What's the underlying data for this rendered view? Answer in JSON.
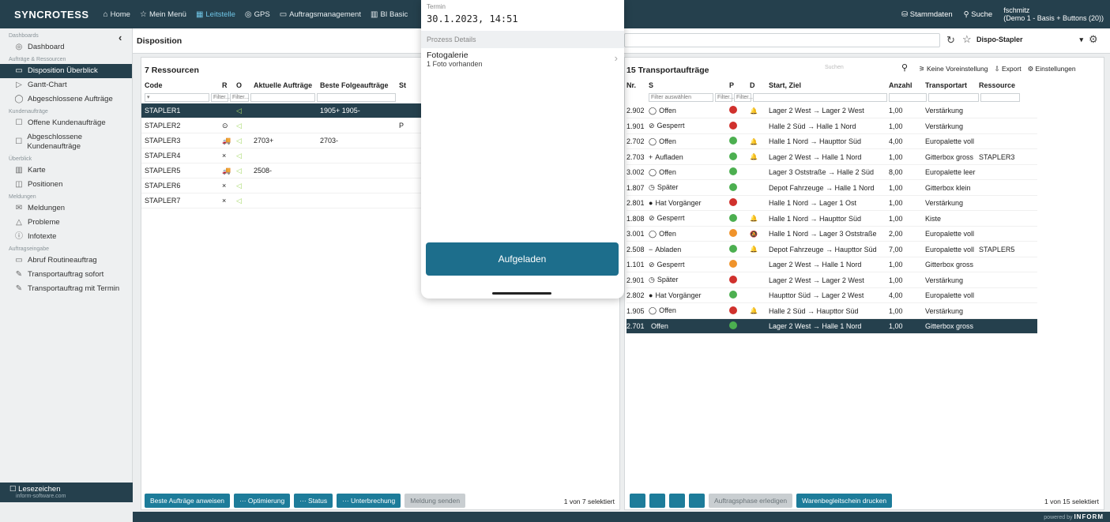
{
  "app": {
    "brand": "SYNCROTESS"
  },
  "topnav": [
    {
      "label": "Home",
      "icon": "⌂",
      "active": false
    },
    {
      "label": "Mein Menü",
      "icon": "☆",
      "active": false
    },
    {
      "label": "Leitstelle",
      "icon": "▦",
      "active": true
    },
    {
      "label": "GPS",
      "icon": "◎",
      "active": false
    },
    {
      "label": "Auftragsmanagement",
      "icon": "▭",
      "active": false
    },
    {
      "label": "BI Basic",
      "icon": "▥",
      "active": false
    }
  ],
  "topright": {
    "stammdaten": "Stammdaten",
    "suche": "Suche",
    "user": "fschmitz",
    "user_detail": "(Demo 1 - Basis + Buttons (20))"
  },
  "sidebar": {
    "groups": [
      {
        "title": "Dashboards",
        "items": [
          {
            "label": "Dashboard",
            "icon": "◎"
          }
        ]
      },
      {
        "title": "Aufträge & Ressourcen",
        "items": [
          {
            "label": "Disposition Überblick",
            "icon": "▭",
            "active": true
          },
          {
            "label": "Gantt-Chart",
            "icon": "▷"
          },
          {
            "label": "Abgeschlossene Aufträge",
            "icon": "◯"
          }
        ]
      },
      {
        "title": "Kundenaufträge",
        "items": [
          {
            "label": "Offene Kundenaufträge",
            "icon": "☐"
          },
          {
            "label": "Abgeschlossene Kundenaufträge",
            "icon": "☐"
          }
        ]
      },
      {
        "title": "Überblick",
        "items": [
          {
            "label": "Karte",
            "icon": "▥"
          },
          {
            "label": "Positionen",
            "icon": "◫"
          }
        ]
      },
      {
        "title": "Meldungen",
        "items": [
          {
            "label": "Meldungen",
            "icon": "✉"
          },
          {
            "label": "Probleme",
            "icon": "△"
          },
          {
            "label": "Infotexte",
            "icon": "ⓘ"
          }
        ]
      },
      {
        "title": "Auftragseingabe",
        "items": [
          {
            "label": "Abruf Routineauftrag",
            "icon": "▭"
          },
          {
            "label": "Transportauftrag sofort",
            "icon": "✎"
          },
          {
            "label": "Transportauftrag mit Termin",
            "icon": "✎"
          }
        ]
      }
    ],
    "bookmarks": "Lesezeichen",
    "bookmarks_sub": "inform-software.com"
  },
  "disposition": {
    "title": "Disposition",
    "search_placeholder": "Suchen",
    "view_select": "Dispo-Stapler"
  },
  "resources": {
    "title": "7 Ressourcen",
    "columns": [
      "Code",
      "R",
      "O",
      "Aktuelle Aufträge",
      "Beste Folgeaufträge",
      "St"
    ],
    "filter": "Filter...",
    "rows": [
      {
        "code": "STAPLER1",
        "r": "",
        "o": "◁",
        "current": "",
        "next": "1905+ 1905-",
        "st": "",
        "sel": true
      },
      {
        "code": "STAPLER2",
        "r": "⊙",
        "o": "◁",
        "current": "",
        "next": "",
        "st": "P"
      },
      {
        "code": "STAPLER3",
        "r": "🚚",
        "o": "◁",
        "current": "2703+",
        "next": "2703-",
        "st": ""
      },
      {
        "code": "STAPLER4",
        "r": "×",
        "o": "◁",
        "current": "",
        "next": "",
        "st": ""
      },
      {
        "code": "STAPLER5",
        "r": "🚚",
        "o": "◁",
        "current": "2508-",
        "next": "",
        "st": ""
      },
      {
        "code": "STAPLER6",
        "r": "×",
        "o": "◁",
        "current": "",
        "next": "",
        "st": ""
      },
      {
        "code": "STAPLER7",
        "r": "×",
        "o": "◁",
        "current": "",
        "next": "",
        "st": ""
      }
    ],
    "buttons": [
      {
        "label": "Beste Aufträge anweisen",
        "dis": false
      },
      {
        "label": "··· Optimierung",
        "dis": false
      },
      {
        "label": "··· Status",
        "dis": false
      },
      {
        "label": "··· Unterbrechung",
        "dis": false
      },
      {
        "label": "Meldung senden",
        "dis": true
      }
    ],
    "count": "1 von 7 selektiert"
  },
  "orders": {
    "title": "15 Transportaufträge",
    "search_placeholder": "Suchen",
    "toolbar": [
      "Keine Voreinstellung",
      "Export",
      "Einstellungen"
    ],
    "columns": [
      "Nr.",
      "S",
      "P",
      "D",
      "Start, Ziel",
      "Anzahl",
      "Transportart",
      "Ressource"
    ],
    "filter_select": "Filter auswählen",
    "filter": "Filter...",
    "rows": [
      {
        "nr": "2.902",
        "s_icon": "◯",
        "s": "Offen",
        "p": "#d0312d",
        "d": "🔔",
        "route": "Lager 2 West → Lager 2 West",
        "qty": "1,00",
        "type": "Verstärkung",
        "res": ""
      },
      {
        "nr": "1.901",
        "s_icon": "⊘",
        "s": "Gesperrt",
        "p": "#d0312d",
        "d": "",
        "route": "Halle 2 Süd → Halle 1 Nord",
        "qty": "1,00",
        "type": "Verstärkung",
        "res": ""
      },
      {
        "nr": "2.702",
        "s_icon": "◯",
        "s": "Offen",
        "p": "#4caf50",
        "d": "🔔",
        "route": "Halle 1 Nord → Haupttor Süd",
        "qty": "4,00",
        "type": "Europalette voll",
        "res": ""
      },
      {
        "nr": "2.703",
        "s_icon": "+",
        "s": "Aufladen",
        "p": "#4caf50",
        "d": "🔔",
        "route": "Lager 2 West → Halle 1 Nord",
        "qty": "1,00",
        "type": "Gitterbox gross",
        "res": "STAPLER3"
      },
      {
        "nr": "3.002",
        "s_icon": "◯",
        "s": "Offen",
        "p": "#4caf50",
        "d": "",
        "route": "Lager 3 Oststraße → Halle 2 Süd",
        "qty": "8,00",
        "type": "Europalette leer",
        "res": ""
      },
      {
        "nr": "1.807",
        "s_icon": "◷",
        "s": "Später",
        "p": "#4caf50",
        "d": "",
        "route": "Depot Fahrzeuge → Halle 1 Nord",
        "qty": "1,00",
        "type": "Gitterbox klein",
        "res": ""
      },
      {
        "nr": "2.801",
        "s_icon": "●",
        "s": "Hat Vorgänger",
        "p": "#d0312d",
        "d": "",
        "route": "Halle 1 Nord → Lager 1 Ost",
        "qty": "1,00",
        "type": "Verstärkung",
        "res": ""
      },
      {
        "nr": "1.808",
        "s_icon": "⊘",
        "s": "Gesperrt",
        "p": "#4caf50",
        "d": "🔔",
        "route": "Halle 1 Nord → Haupttor Süd",
        "qty": "1,00",
        "type": "Kiste",
        "res": ""
      },
      {
        "nr": "3.001",
        "s_icon": "◯",
        "s": "Offen",
        "p": "#f0932b",
        "d": "🔕",
        "route": "Halle 1 Nord → Lager 3 Oststraße",
        "qty": "2,00",
        "type": "Europalette voll",
        "res": ""
      },
      {
        "nr": "2.508",
        "s_icon": "−",
        "s": "Abladen",
        "p": "#4caf50",
        "d": "🔔",
        "route": "Depot Fahrzeuge → Haupttor Süd",
        "qty": "7,00",
        "type": "Europalette voll",
        "res": "STAPLER5"
      },
      {
        "nr": "1.101",
        "s_icon": "⊘",
        "s": "Gesperrt",
        "p": "#f0932b",
        "d": "",
        "route": "Lager 2 West → Halle 1 Nord",
        "qty": "1,00",
        "type": "Gitterbox gross",
        "res": ""
      },
      {
        "nr": "2.901",
        "s_icon": "◷",
        "s": "Später",
        "p": "#d0312d",
        "d": "",
        "route": "Lager 2 West → Lager 2 West",
        "qty": "1,00",
        "type": "Verstärkung",
        "res": ""
      },
      {
        "nr": "2.802",
        "s_icon": "●",
        "s": "Hat Vorgänger",
        "p": "#4caf50",
        "d": "",
        "route": "Haupttor Süd → Lager 2 West",
        "qty": "4,00",
        "type": "Europalette voll",
        "res": ""
      },
      {
        "nr": "1.905",
        "s_icon": "◯",
        "s": "Offen",
        "p": "#d0312d",
        "d": "🔔",
        "route": "Halle 2 Süd → Haupttor Süd",
        "qty": "1,00",
        "type": "Verstärkung",
        "res": ""
      },
      {
        "nr": "2.701",
        "s_icon": "",
        "s": "Offen",
        "p": "#4caf50",
        "d": "",
        "route": "Lager 2 West → Halle 1 Nord",
        "qty": "1,00",
        "type": "Gitterbox gross",
        "res": "",
        "sel": true
      }
    ],
    "buttons": [
      {
        "label": "Auftragsphase erledigen",
        "dis": true
      },
      {
        "label": "Warenbegleitschein drucken",
        "dis": false
      }
    ],
    "count": "1 von 15 selektiert"
  },
  "modal": {
    "termin_label": "Termin",
    "termin_value": "30.1.2023, 14:51",
    "section": "Prozess Details",
    "gallery_title": "Fotogalerie",
    "gallery_sub": "1 Foto vorhanden",
    "action": "Aufgeladen"
  },
  "footer": {
    "powered": "powered by",
    "brand": "INFORM"
  }
}
